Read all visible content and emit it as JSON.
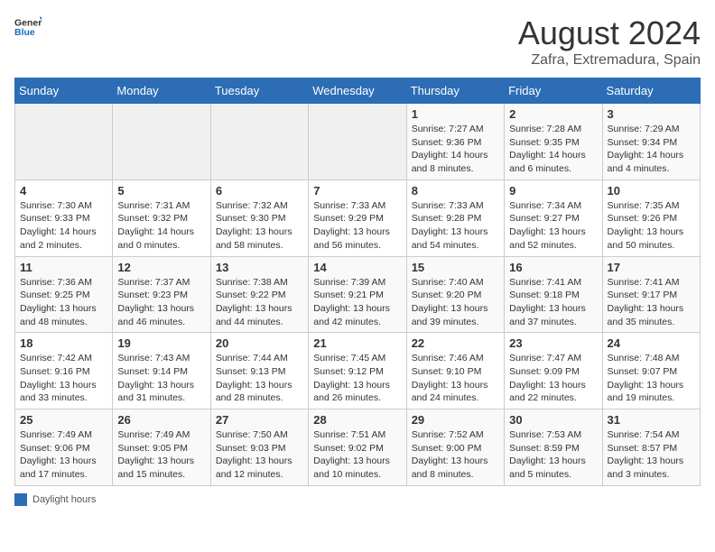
{
  "header": {
    "logo_general": "General",
    "logo_blue": "Blue",
    "title": "August 2024",
    "subtitle": "Zafra, Extremadura, Spain"
  },
  "calendar": {
    "days_of_week": [
      "Sunday",
      "Monday",
      "Tuesday",
      "Wednesday",
      "Thursday",
      "Friday",
      "Saturday"
    ],
    "weeks": [
      [
        {
          "day": "",
          "info": ""
        },
        {
          "day": "",
          "info": ""
        },
        {
          "day": "",
          "info": ""
        },
        {
          "day": "",
          "info": ""
        },
        {
          "day": "1",
          "info": "Sunrise: 7:27 AM\nSunset: 9:36 PM\nDaylight: 14 hours and 8 minutes."
        },
        {
          "day": "2",
          "info": "Sunrise: 7:28 AM\nSunset: 9:35 PM\nDaylight: 14 hours and 6 minutes."
        },
        {
          "day": "3",
          "info": "Sunrise: 7:29 AM\nSunset: 9:34 PM\nDaylight: 14 hours and 4 minutes."
        }
      ],
      [
        {
          "day": "4",
          "info": "Sunrise: 7:30 AM\nSunset: 9:33 PM\nDaylight: 14 hours and 2 minutes."
        },
        {
          "day": "5",
          "info": "Sunrise: 7:31 AM\nSunset: 9:32 PM\nDaylight: 14 hours and 0 minutes."
        },
        {
          "day": "6",
          "info": "Sunrise: 7:32 AM\nSunset: 9:30 PM\nDaylight: 13 hours and 58 minutes."
        },
        {
          "day": "7",
          "info": "Sunrise: 7:33 AM\nSunset: 9:29 PM\nDaylight: 13 hours and 56 minutes."
        },
        {
          "day": "8",
          "info": "Sunrise: 7:33 AM\nSunset: 9:28 PM\nDaylight: 13 hours and 54 minutes."
        },
        {
          "day": "9",
          "info": "Sunrise: 7:34 AM\nSunset: 9:27 PM\nDaylight: 13 hours and 52 minutes."
        },
        {
          "day": "10",
          "info": "Sunrise: 7:35 AM\nSunset: 9:26 PM\nDaylight: 13 hours and 50 minutes."
        }
      ],
      [
        {
          "day": "11",
          "info": "Sunrise: 7:36 AM\nSunset: 9:25 PM\nDaylight: 13 hours and 48 minutes."
        },
        {
          "day": "12",
          "info": "Sunrise: 7:37 AM\nSunset: 9:23 PM\nDaylight: 13 hours and 46 minutes."
        },
        {
          "day": "13",
          "info": "Sunrise: 7:38 AM\nSunset: 9:22 PM\nDaylight: 13 hours and 44 minutes."
        },
        {
          "day": "14",
          "info": "Sunrise: 7:39 AM\nSunset: 9:21 PM\nDaylight: 13 hours and 42 minutes."
        },
        {
          "day": "15",
          "info": "Sunrise: 7:40 AM\nSunset: 9:20 PM\nDaylight: 13 hours and 39 minutes."
        },
        {
          "day": "16",
          "info": "Sunrise: 7:41 AM\nSunset: 9:18 PM\nDaylight: 13 hours and 37 minutes."
        },
        {
          "day": "17",
          "info": "Sunrise: 7:41 AM\nSunset: 9:17 PM\nDaylight: 13 hours and 35 minutes."
        }
      ],
      [
        {
          "day": "18",
          "info": "Sunrise: 7:42 AM\nSunset: 9:16 PM\nDaylight: 13 hours and 33 minutes."
        },
        {
          "day": "19",
          "info": "Sunrise: 7:43 AM\nSunset: 9:14 PM\nDaylight: 13 hours and 31 minutes."
        },
        {
          "day": "20",
          "info": "Sunrise: 7:44 AM\nSunset: 9:13 PM\nDaylight: 13 hours and 28 minutes."
        },
        {
          "day": "21",
          "info": "Sunrise: 7:45 AM\nSunset: 9:12 PM\nDaylight: 13 hours and 26 minutes."
        },
        {
          "day": "22",
          "info": "Sunrise: 7:46 AM\nSunset: 9:10 PM\nDaylight: 13 hours and 24 minutes."
        },
        {
          "day": "23",
          "info": "Sunrise: 7:47 AM\nSunset: 9:09 PM\nDaylight: 13 hours and 22 minutes."
        },
        {
          "day": "24",
          "info": "Sunrise: 7:48 AM\nSunset: 9:07 PM\nDaylight: 13 hours and 19 minutes."
        }
      ],
      [
        {
          "day": "25",
          "info": "Sunrise: 7:49 AM\nSunset: 9:06 PM\nDaylight: 13 hours and 17 minutes."
        },
        {
          "day": "26",
          "info": "Sunrise: 7:49 AM\nSunset: 9:05 PM\nDaylight: 13 hours and 15 minutes."
        },
        {
          "day": "27",
          "info": "Sunrise: 7:50 AM\nSunset: 9:03 PM\nDaylight: 13 hours and 12 minutes."
        },
        {
          "day": "28",
          "info": "Sunrise: 7:51 AM\nSunset: 9:02 PM\nDaylight: 13 hours and 10 minutes."
        },
        {
          "day": "29",
          "info": "Sunrise: 7:52 AM\nSunset: 9:00 PM\nDaylight: 13 hours and 8 minutes."
        },
        {
          "day": "30",
          "info": "Sunrise: 7:53 AM\nSunset: 8:59 PM\nDaylight: 13 hours and 5 minutes."
        },
        {
          "day": "31",
          "info": "Sunrise: 7:54 AM\nSunset: 8:57 PM\nDaylight: 13 hours and 3 minutes."
        }
      ]
    ]
  },
  "legend": {
    "label": "Daylight hours"
  }
}
